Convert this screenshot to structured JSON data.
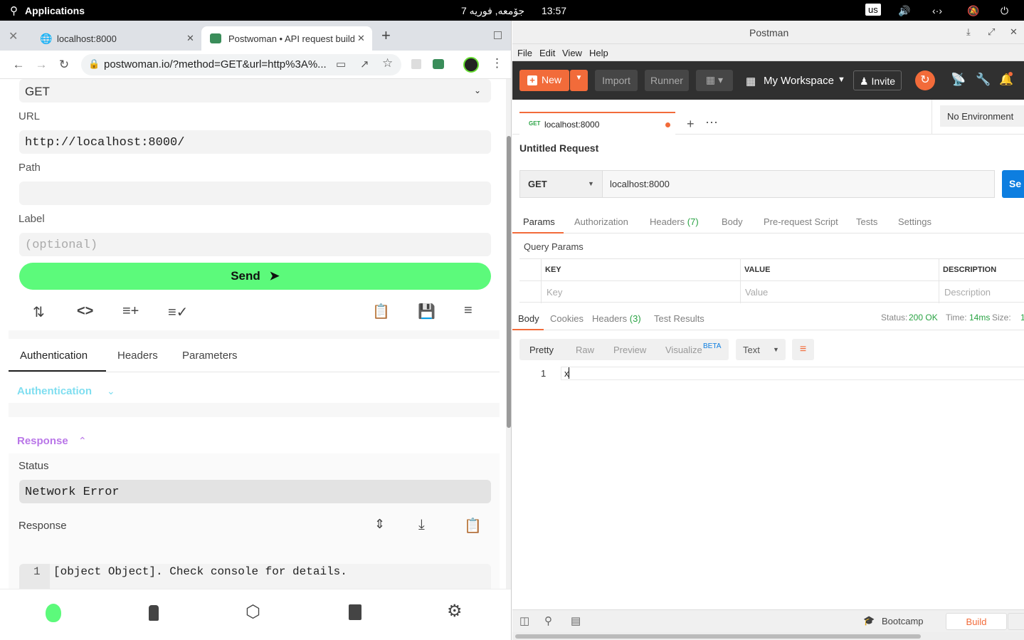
{
  "topbar": {
    "applications": "Applications",
    "date": "جۆمعە, فوريە 7",
    "time": "13:57",
    "keyboard": "us"
  },
  "chrome": {
    "tabs": [
      {
        "title": "localhost:8000"
      },
      {
        "title": "Postwoman • API request builde"
      }
    ],
    "url": "postwoman.io/?method=GET&url=http%3A%..."
  },
  "postwoman": {
    "method": "GET",
    "url_label": "URL",
    "url_value": "http://localhost:8000/",
    "path_label": "Path",
    "path_value": "",
    "label_label": "Label",
    "label_placeholder": "(optional)",
    "send_label": "Send",
    "tabs": [
      "Authentication",
      "Headers",
      "Parameters"
    ],
    "auth_section": "Authentication",
    "response_section": "Response",
    "status_label": "Status",
    "status_value": "Network Error",
    "response_label": "Response",
    "response_line_no": "1",
    "response_text": "[object Object]. Check console for details."
  },
  "postman": {
    "window_title": "Postman",
    "menu": [
      "File",
      "Edit",
      "View",
      "Help"
    ],
    "new_label": "New",
    "import_label": "Import",
    "runner_label": "Runner",
    "workspace": "My Workspace",
    "invite": "Invite",
    "req_tab_method": "GET",
    "req_tab_name": "localhost:8000",
    "environment": "No Environment",
    "request_title": "Untitled Request",
    "method": "GET",
    "url": "localhost:8000",
    "send_partial": "Se",
    "req_tabs": {
      "params": "Params",
      "authorization": "Authorization",
      "headers": "Headers",
      "headers_count": "(7)",
      "body": "Body",
      "prerequest": "Pre-request Script",
      "tests": "Tests",
      "settings": "Settings"
    },
    "query_params": "Query Params",
    "table_headers": [
      "KEY",
      "VALUE",
      "DESCRIPTION"
    ],
    "table_placeholders": [
      "Key",
      "Value",
      "Description"
    ],
    "resp_tabs": {
      "body": "Body",
      "cookies": "Cookies",
      "headers": "Headers",
      "headers_count": "(3)",
      "test_results": "Test Results"
    },
    "status_label": "Status:",
    "status_value": "200 OK",
    "time_label": "Time:",
    "time_value": "14ms",
    "size_label": "Size:",
    "size_partial": "1",
    "view_modes": [
      "Pretty",
      "Raw",
      "Preview",
      "Visualize"
    ],
    "beta": "BETA",
    "format": "Text",
    "line_no": "1",
    "line_text": "x",
    "bootcamp": "Bootcamp",
    "build": "Build"
  },
  "colors": {
    "postwoman_green": "#5cfa7b",
    "postman_orange": "#f26b3a",
    "status_green": "#2aa344",
    "auth_cyan": "#7fdef0",
    "response_purple": "#b976e8"
  }
}
